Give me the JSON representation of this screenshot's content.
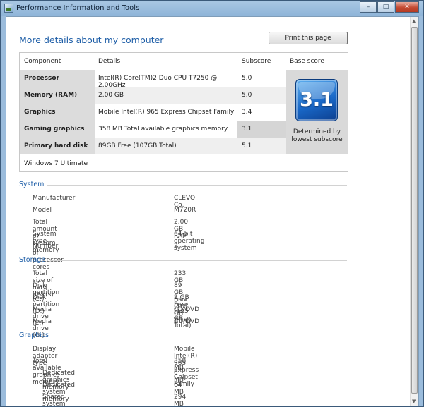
{
  "window": {
    "title": "Performance Information and Tools"
  },
  "caption": {
    "minimize": "–",
    "maximize": "□",
    "close": "✕"
  },
  "heading": "More details about my computer",
  "print_button": "Print this page",
  "score_table": {
    "headers": [
      "Component",
      "Details",
      "Subscore",
      "Base score"
    ],
    "rows": [
      {
        "component": "Processor",
        "details": "Intel(R) Core(TM)2 Duo CPU T7250 @ 2.00GHz",
        "subscore": "5.0"
      },
      {
        "component": "Memory (RAM)",
        "details": "2.00 GB",
        "subscore": "5.0"
      },
      {
        "component": "Graphics",
        "details": "Mobile Intel(R) 965 Express Chipset Family",
        "subscore": "3.4"
      },
      {
        "component": "Gaming graphics",
        "details": "358 MB Total available graphics memory",
        "subscore": "3.1"
      },
      {
        "component": "Primary hard disk",
        "details": "89GB Free (107GB Total)",
        "subscore": "5.1"
      }
    ],
    "base_score": "3.1",
    "base_note": "Determined by lowest subscore",
    "edition": "Windows 7 Ultimate"
  },
  "system": {
    "title": "System",
    "items": [
      {
        "k": "Manufacturer",
        "v": "CLEVO Co."
      },
      {
        "k": "Model",
        "v": "M720R"
      },
      {
        "k": "Total amount of system memory",
        "v": "2.00 GB RAM"
      },
      {
        "k": "System type",
        "v": "64-bit operating system"
      },
      {
        "k": "Number of processor cores",
        "v": "2"
      }
    ]
  },
  "storage": {
    "title": "Storage",
    "items": [
      {
        "k": "Total size of hard disk(s)",
        "v": "233 GB"
      },
      {
        "k": "Disk partition (C:)",
        "v": "89 GB Free (107 GB Total)"
      },
      {
        "k": "Disk partition (D:)",
        "v": "2 GB Free (125 GB Total)"
      },
      {
        "k": "Media drive (E:)",
        "v": "CD/DVD"
      },
      {
        "k": "Media drive (G:)",
        "v": "CD/DVD"
      }
    ]
  },
  "graphics": {
    "title": "Graphics",
    "items": [
      {
        "k": "Display adapter type",
        "v": "Mobile Intel(R) 965 Express Chipset Family"
      },
      {
        "k": "Total available graphics memory",
        "v": "358 MB"
      },
      {
        "k": "Dedicated graphics memory",
        "v": "0 MB"
      },
      {
        "k": "Dedicated system memory",
        "v": "64 MB"
      },
      {
        "k": "Shared system memory",
        "v": "294 MB"
      }
    ]
  }
}
